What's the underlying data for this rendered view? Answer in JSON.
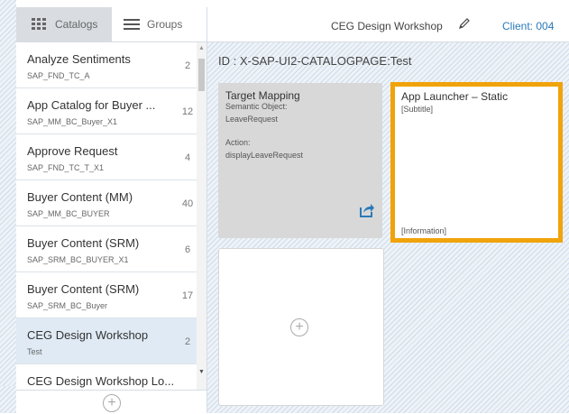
{
  "sidebar": {
    "tabs": [
      {
        "label": "Catalogs",
        "icon": "grid-icon"
      },
      {
        "label": "Groups",
        "icon": "list-icon"
      }
    ],
    "items": [
      {
        "title": "Analyze Sentiments",
        "id": "SAP_FND_TC_A",
        "count": "2"
      },
      {
        "title": "App Catalog for Buyer ...",
        "id": "SAP_MM_BC_Buyer_X1",
        "count": "12"
      },
      {
        "title": "Approve Request",
        "id": "SAP_FND_TC_T_X1",
        "count": "4"
      },
      {
        "title": "Buyer Content (MM)",
        "id": "SAP_MM_BC_BUYER",
        "count": "40"
      },
      {
        "title": "Buyer Content (SRM)",
        "id": "SAP_SRM_BC_BUYER_X1",
        "count": "6"
      },
      {
        "title": "Buyer Content (SRM)",
        "id": "SAP_SRM_BC_Buyer",
        "count": "17"
      },
      {
        "title": "CEG Design Workshop",
        "id": "Test",
        "count": "2"
      },
      {
        "title": "CEG Design Workshop Lo...",
        "id": "",
        "count": ""
      }
    ],
    "add_symbol": "+"
  },
  "header": {
    "title": "CEG Design Workshop",
    "client": "Client: 004"
  },
  "content": {
    "page_id": "ID : X-SAP-UI2-CATALOGPAGE:Test",
    "target_mapping": {
      "title": "Target Mapping",
      "semantic_label": "Semantic Object:",
      "semantic_value": "LeaveRequest",
      "action_label": "Action:",
      "action_value": "displayLeaveRequest"
    },
    "app_launcher": {
      "title": "App Launcher – Static",
      "subtitle": "[Subtitle]",
      "info": "[Information]"
    },
    "add_symbol": "+"
  },
  "colors": {
    "accent": "#2a7ab8",
    "highlight_border": "#f0a30a",
    "selected_item": "#dfeaf4"
  }
}
